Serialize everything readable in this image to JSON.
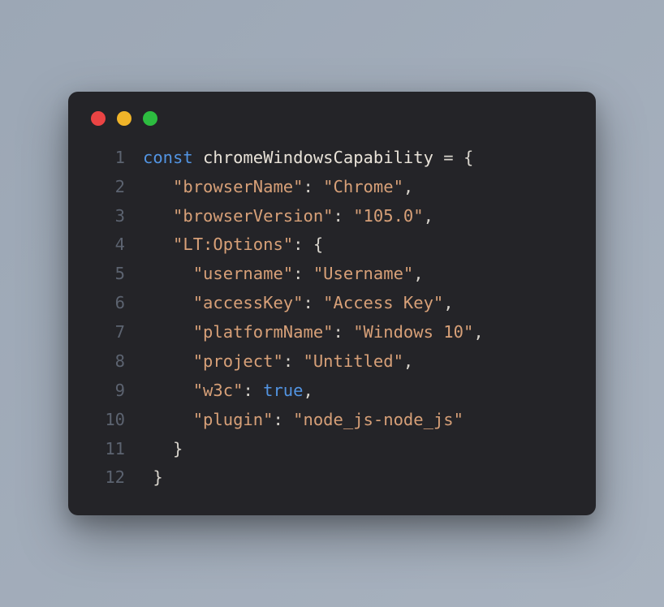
{
  "colors": {
    "background": "#9ca7b5",
    "window": "#242428",
    "red": "#EB4444",
    "yellow": "#F0B429",
    "green": "#2DBC40",
    "keyword": "#5294e2",
    "identifier": "#e8e2d8",
    "punctuation": "#d8d4cc",
    "string": "#d7a078",
    "boolean": "#5294e2",
    "lineNumber": "#5c6370"
  },
  "lines": [
    {
      "num": "1",
      "segments": [
        {
          "cls": "kw",
          "text": "const"
        },
        {
          "cls": "ident",
          "text": " chromeWindowsCapability "
        },
        {
          "cls": "op",
          "text": "="
        },
        {
          "cls": "punct",
          "text": " {"
        }
      ]
    },
    {
      "num": "2",
      "segments": [
        {
          "cls": "punct",
          "text": "   "
        },
        {
          "cls": "str",
          "text": "\"browserName\""
        },
        {
          "cls": "punct",
          "text": ": "
        },
        {
          "cls": "str",
          "text": "\"Chrome\""
        },
        {
          "cls": "punct",
          "text": ","
        }
      ]
    },
    {
      "num": "3",
      "segments": [
        {
          "cls": "punct",
          "text": "   "
        },
        {
          "cls": "str",
          "text": "\"browserVersion\""
        },
        {
          "cls": "punct",
          "text": ": "
        },
        {
          "cls": "str",
          "text": "\"105.0\""
        },
        {
          "cls": "punct",
          "text": ","
        }
      ]
    },
    {
      "num": "4",
      "segments": [
        {
          "cls": "punct",
          "text": "   "
        },
        {
          "cls": "str",
          "text": "\"LT:Options\""
        },
        {
          "cls": "punct",
          "text": ": {"
        }
      ]
    },
    {
      "num": "5",
      "segments": [
        {
          "cls": "punct",
          "text": "     "
        },
        {
          "cls": "str",
          "text": "\"username\""
        },
        {
          "cls": "punct",
          "text": ": "
        },
        {
          "cls": "str",
          "text": "\"Username\""
        },
        {
          "cls": "punct",
          "text": ","
        }
      ]
    },
    {
      "num": "6",
      "segments": [
        {
          "cls": "punct",
          "text": "     "
        },
        {
          "cls": "str",
          "text": "\"accessKey\""
        },
        {
          "cls": "punct",
          "text": ": "
        },
        {
          "cls": "str",
          "text": "\"Access Key\""
        },
        {
          "cls": "punct",
          "text": ","
        }
      ]
    },
    {
      "num": "7",
      "segments": [
        {
          "cls": "punct",
          "text": "     "
        },
        {
          "cls": "str",
          "text": "\"platformName\""
        },
        {
          "cls": "punct",
          "text": ": "
        },
        {
          "cls": "str",
          "text": "\"Windows 10\""
        },
        {
          "cls": "punct",
          "text": ","
        }
      ]
    },
    {
      "num": "8",
      "segments": [
        {
          "cls": "punct",
          "text": "     "
        },
        {
          "cls": "str",
          "text": "\"project\""
        },
        {
          "cls": "punct",
          "text": ": "
        },
        {
          "cls": "str",
          "text": "\"Untitled\""
        },
        {
          "cls": "punct",
          "text": ","
        }
      ]
    },
    {
      "num": "9",
      "segments": [
        {
          "cls": "punct",
          "text": "     "
        },
        {
          "cls": "str",
          "text": "\"w3c\""
        },
        {
          "cls": "punct",
          "text": ": "
        },
        {
          "cls": "bool",
          "text": "true"
        },
        {
          "cls": "punct",
          "text": ","
        }
      ]
    },
    {
      "num": "10",
      "segments": [
        {
          "cls": "punct",
          "text": "     "
        },
        {
          "cls": "str",
          "text": "\"plugin\""
        },
        {
          "cls": "punct",
          "text": ": "
        },
        {
          "cls": "str",
          "text": "\"node_js-node_js\""
        }
      ]
    },
    {
      "num": "11",
      "segments": [
        {
          "cls": "punct",
          "text": "   }"
        }
      ]
    },
    {
      "num": "12",
      "segments": [
        {
          "cls": "punct",
          "text": " }"
        }
      ]
    }
  ]
}
